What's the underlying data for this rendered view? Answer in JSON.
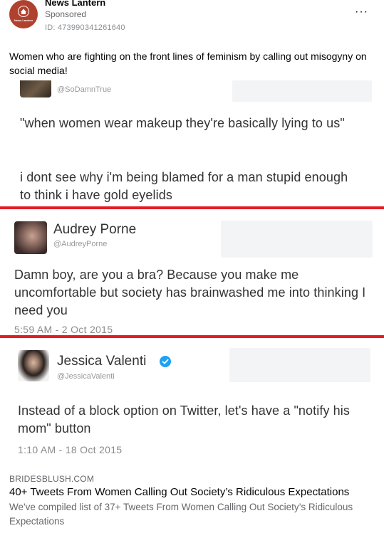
{
  "post": {
    "page_name": "News Lantern",
    "avatar_text": "News Lantern",
    "sponsored": "Sponsored",
    "ad_id": "ID: 473990341261640",
    "more": "···",
    "caption": "Women who are fighting on the front lines of feminism by calling out misogyny on social media!"
  },
  "tweets": [
    {
      "handle": "@SoDamnTrue",
      "body1": "\"when women wear makeup they're basically lying to us\"",
      "body2": "i dont see why i'm being blamed for a man stupid enough to think i have gold eyelids"
    },
    {
      "name": "Audrey Porne",
      "handle": "@AudreyPorne",
      "body": "Damn boy, are you a bra? Because you make me uncomfortable but society has brainwashed me into thinking I need you",
      "time": "5:59 AM - 2 Oct 2015"
    },
    {
      "name": "Jessica Valenti",
      "handle": "@JessicaValenti",
      "body": "Instead of a block option on Twitter, let's have a \"notify his mom\" button",
      "time": "1:10 AM - 18 Oct 2015"
    }
  ],
  "link": {
    "domain": "BRIDESBLUSH.COM",
    "title": "40+ Tweets From Women Calling Out Society’s Ridiculous Expectations",
    "description": "We've compiled list of 37+ Tweets From Women Calling Out Society’s Ridiculous Expectations"
  },
  "colors": {
    "divider": "#e21e25",
    "verified": "#1da1f2",
    "brand_avatar": "#b0412e"
  }
}
